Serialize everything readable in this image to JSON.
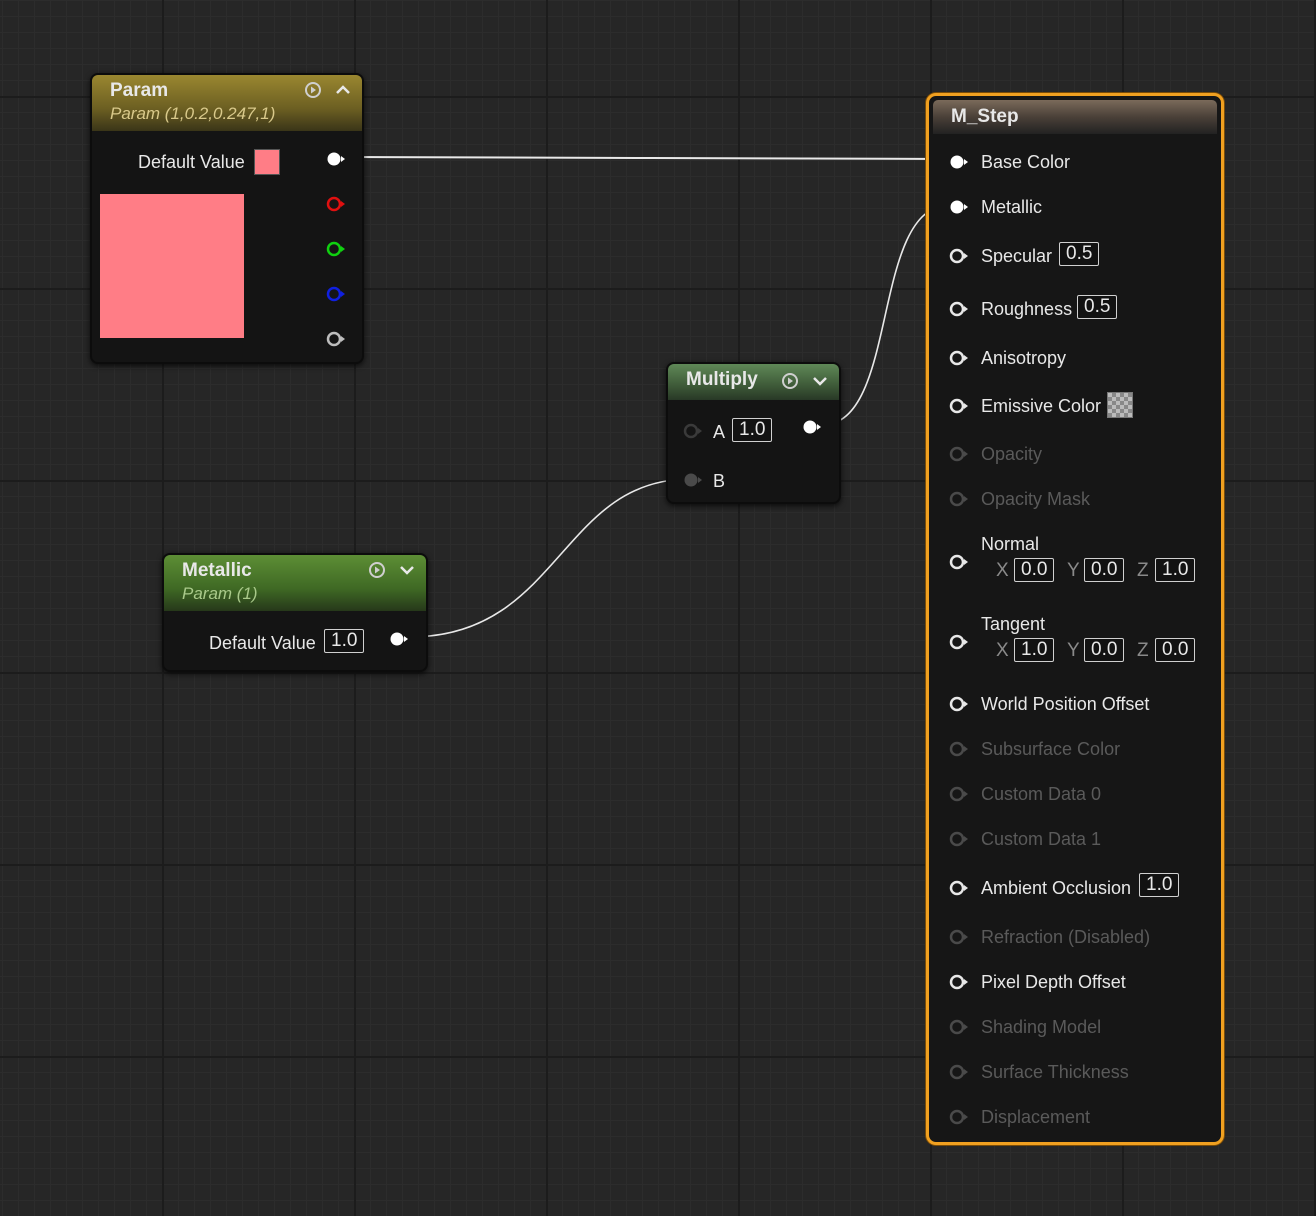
{
  "nodes": {
    "param": {
      "title": "Param",
      "subtitle": "Param (1,0.2,0.247,1)",
      "default_label": "Default Value",
      "swatch_color": "#ff7d86"
    },
    "metallic": {
      "title": "Metallic",
      "subtitle": "Param (1)",
      "default_label": "Default Value",
      "default_value": "1.0"
    },
    "multiply": {
      "title": "Multiply",
      "a_label": "A",
      "a_value": "1.0",
      "b_label": "B"
    },
    "material": {
      "title": "M_Step",
      "pins": {
        "base_color": "Base Color",
        "metallic": "Metallic",
        "specular": "Specular",
        "specular_value": "0.5",
        "roughness": "Roughness",
        "roughness_value": "0.5",
        "anisotropy": "Anisotropy",
        "emissive": "Emissive Color",
        "opacity": "Opacity",
        "opacity_mask": "Opacity Mask",
        "normal": "Normal",
        "normal_x": "0.0",
        "normal_y": "0.0",
        "normal_z": "1.0",
        "tangent": "Tangent",
        "tangent_x": "1.0",
        "tangent_y": "0.0",
        "tangent_z": "0.0",
        "wpo": "World Position Offset",
        "subsurface": "Subsurface Color",
        "custom0": "Custom Data 0",
        "custom1": "Custom Data 1",
        "ao": "Ambient Occlusion",
        "ao_value": "1.0",
        "refraction": "Refraction (Disabled)",
        "pdo": "Pixel Depth Offset",
        "shading": "Shading Model",
        "thickness": "Surface Thickness",
        "displacement": "Displacement"
      },
      "axis_x": "X",
      "axis_y": "Y",
      "axis_z": "Z"
    }
  },
  "colors": {
    "param_header": "#8a7a28",
    "metallic_header": "#4e7a2c",
    "multiply_header": "#4e7048",
    "material_border": "#f0a020"
  }
}
